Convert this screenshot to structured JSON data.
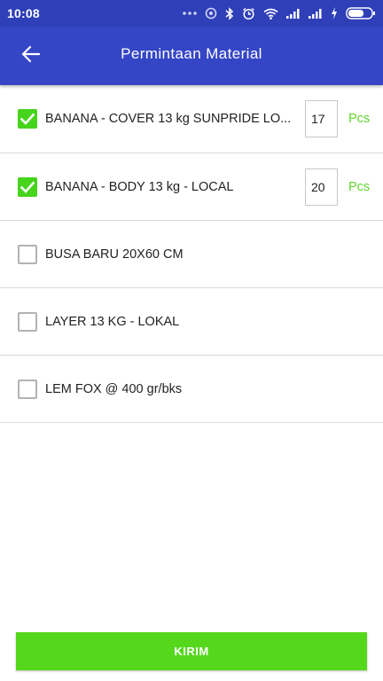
{
  "status_bar": {
    "time": "10:08",
    "icons": [
      "dots-icon",
      "target-icon",
      "bluetooth-icon",
      "alarm-icon",
      "wifi-icon",
      "signal-icon",
      "signal-icon",
      "charging-icon",
      "battery-icon"
    ]
  },
  "app_bar": {
    "title": "Permintaan Material",
    "back_icon": "back-arrow-icon",
    "color": "#3445c6"
  },
  "materials": [
    {
      "label": "BANANA - COVER 13 kg SUNPRIDE LO...",
      "checked": true,
      "quantity": "17",
      "unit": "Pcs"
    },
    {
      "label": "BANANA - BODY 13 kg - LOCAL",
      "checked": true,
      "quantity": "20",
      "unit": "Pcs"
    },
    {
      "label": "BUSA BARU 20X60 CM",
      "checked": false
    },
    {
      "label": "LAYER 13 KG - LOKAL",
      "checked": false
    },
    {
      "label": "LEM FOX @ 400 gr/bks",
      "checked": false
    }
  ],
  "submit_label": "KIRIM",
  "colors": {
    "accent_green": "#55d81c",
    "unit_green": "#5ed42a"
  }
}
